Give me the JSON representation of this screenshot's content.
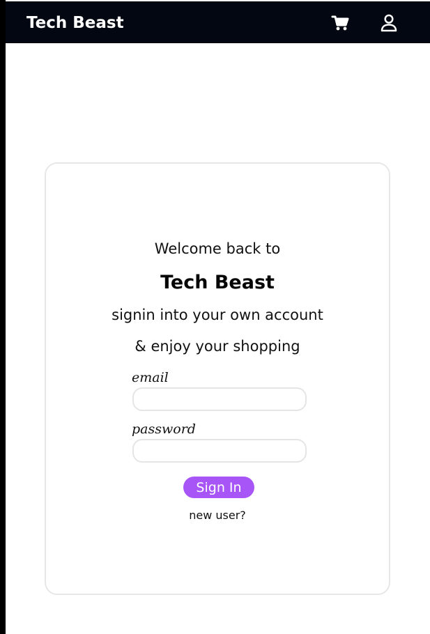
{
  "navbar": {
    "brand": "Tech Beast",
    "icons": [
      "cart-icon",
      "user-icon"
    ],
    "background": "#020711"
  },
  "login": {
    "welcome": "Welcome back to",
    "brand": "Tech Beast",
    "subtitle": "signin into your own account",
    "subtitle2": "& enjoy your shopping",
    "email_label": "email",
    "email_value": "",
    "password_label": "password",
    "password_value": "",
    "button_label": "Sign In",
    "new_user_link": "new user?"
  },
  "colors": {
    "button": "#a855f7",
    "card_border": "#e7e7e7",
    "text": "#111111"
  }
}
